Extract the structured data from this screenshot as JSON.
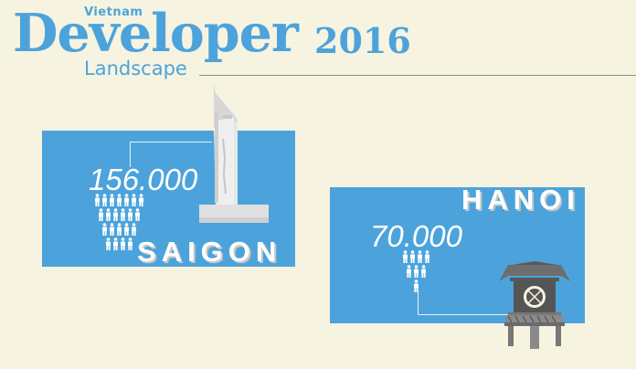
{
  "title": {
    "eyebrow": "Vietnam",
    "main": "Developer",
    "year": "2016",
    "sub": "Landscape"
  },
  "cities": {
    "saigon": {
      "name": "SAIGON",
      "count": "156.000",
      "people_rows": [
        7,
        6,
        5,
        4
      ]
    },
    "hanoi": {
      "name": "HANOI",
      "count": "70.000",
      "people_rows": [
        4,
        3,
        1
      ]
    }
  },
  "colors": {
    "background": "#f7f3e1",
    "panel": "#4ca3db",
    "landmark": "#d9d9d9",
    "pagoda": "#6e6e6e"
  },
  "icons": {
    "saigon_landmark": "bitexco-tower-icon",
    "hanoi_landmark": "one-pillar-pagoda-icon",
    "person": "person-icon"
  }
}
